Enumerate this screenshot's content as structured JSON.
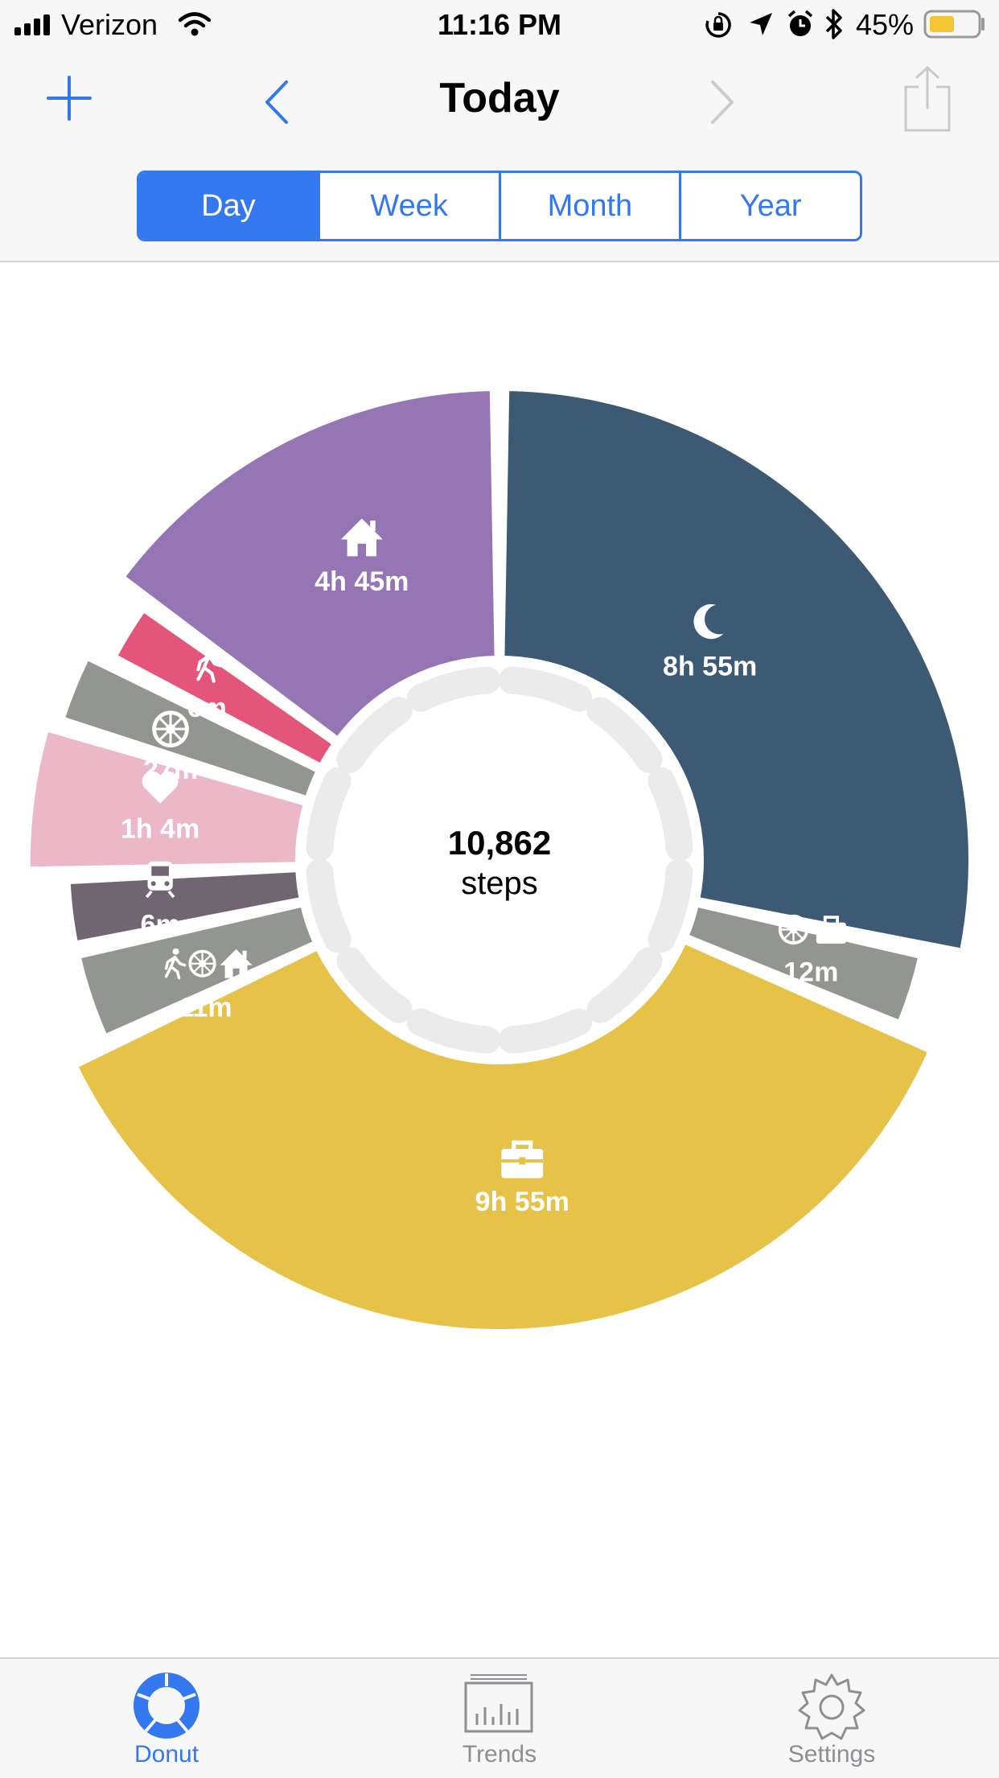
{
  "status": {
    "carrier": "Verizon",
    "time": "11:16 PM",
    "battery": "45%"
  },
  "nav": {
    "title": "Today"
  },
  "segments": [
    "Day",
    "Week",
    "Month",
    "Year"
  ],
  "selected_segment": "Day",
  "chart": {
    "center_value": "10,862",
    "center_unit": "steps",
    "slices": [
      {
        "label": "8h 55m",
        "icon": "moon-icon",
        "color": "#3d5a75"
      },
      {
        "label": "12m",
        "icon": "car-work-icon",
        "color": "#929590"
      },
      {
        "label": "9h 55m",
        "icon": "briefcase-icon",
        "color": "#e7c248"
      },
      {
        "label": "11m",
        "icon": "walk-car-home-icon",
        "color": "#929590"
      },
      {
        "label": "6m",
        "icon": "train-icon",
        "color": "#6f6671"
      },
      {
        "label": "1h 4m",
        "icon": "heart-icon",
        "color": "#ecb7c6"
      },
      {
        "label": "27m",
        "icon": "car-icon",
        "color": "#929590"
      },
      {
        "label": "6m",
        "icon": "walk-icon",
        "color": "#e45679"
      },
      {
        "label": "4h 45m",
        "icon": "home-icon",
        "color": "#9575b4"
      }
    ]
  },
  "tabs": [
    {
      "label": "Donut",
      "icon": "donut-icon",
      "active": true
    },
    {
      "label": "Trends",
      "icon": "trends-icon",
      "active": false
    },
    {
      "label": "Settings",
      "icon": "gear-icon",
      "active": false
    }
  ],
  "colors": {
    "accent": "#3478f0",
    "bar_bg": "#f7f7f7",
    "track": "#ebebeb"
  }
}
